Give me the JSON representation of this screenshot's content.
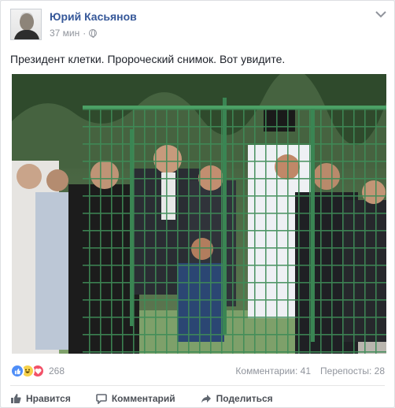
{
  "post": {
    "author": "Юрий Касьянов",
    "time": "37 мин",
    "time_separator": "·",
    "privacy_icon": "globe-icon",
    "text": "Президент клетки. Пророческий снимок. Вот увидите."
  },
  "stats": {
    "reaction_icons": [
      "like-reaction-icon",
      "haha-reaction-icon",
      "love-reaction-icon"
    ],
    "reaction_count": "268",
    "comments": "Комментарии: 41",
    "shares": "Перепосты: 28"
  },
  "actions": {
    "like": "Нравится",
    "comment": "Комментарий",
    "share": "Поделиться"
  },
  "colors": {
    "link": "#365899",
    "like": "#4f8ef7",
    "haha": "#f7d24c",
    "love": "#f25268",
    "fence": "#3f8f58"
  }
}
